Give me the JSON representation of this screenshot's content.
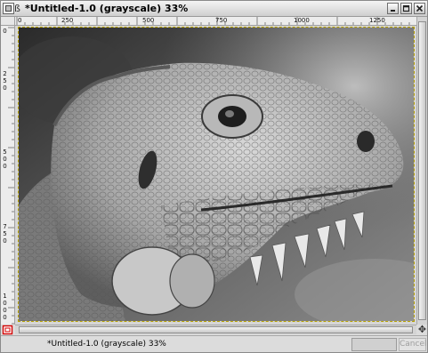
{
  "window": {
    "title": "*Untitled-1.0 (grayscale) 33%",
    "pin_glyph": "ß",
    "icons": [
      "menu-icon",
      "pin-icon",
      "minimize-icon",
      "maximize-icon",
      "close-icon"
    ]
  },
  "rulers": {
    "horizontal_labels": [
      "0",
      "250",
      "500",
      "750",
      "1000",
      "1250"
    ],
    "vertical_labels": [
      "0",
      "2",
      "5",
      "0",
      "5",
      "0",
      "0",
      "7",
      "5",
      "0",
      "1",
      "0",
      "0",
      "0"
    ]
  },
  "canvas": {
    "image_description_icon": "iguana-photo",
    "mode": "grayscale"
  },
  "statusbar": {
    "text": "*Untitled-1.0 (grayscale) 33%",
    "cancel_label": "Cancel"
  },
  "colors": {
    "selection_border": "#b8a200",
    "quickmask_red": "#d40000"
  }
}
